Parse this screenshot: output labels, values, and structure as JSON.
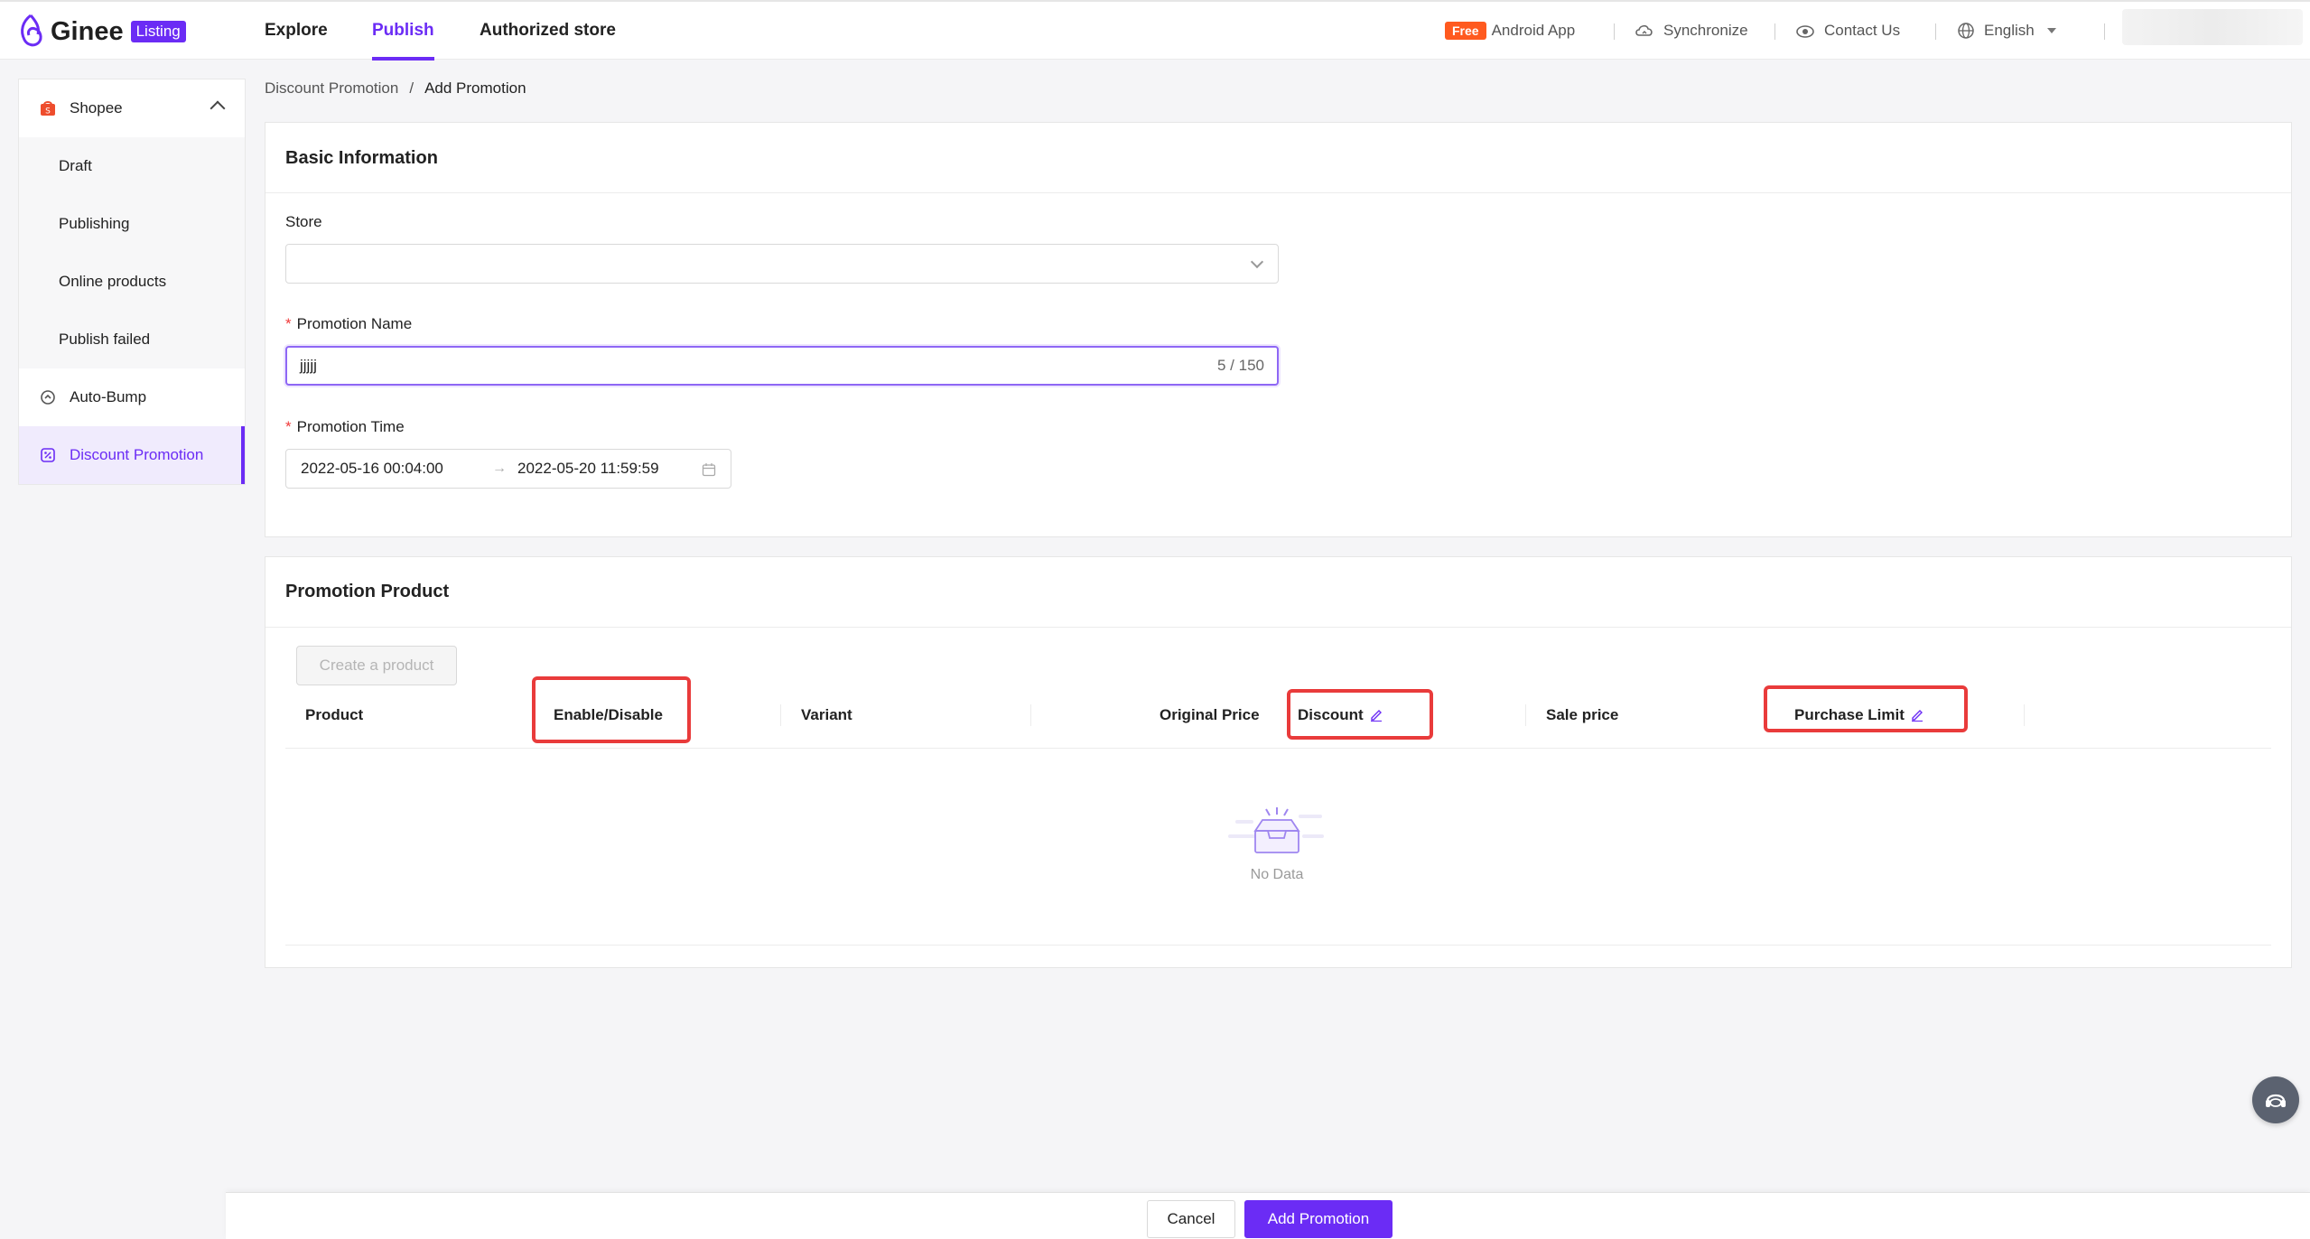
{
  "brand": {
    "name": "Ginee",
    "badge": "Listing",
    "accent": "#6b2cf5"
  },
  "nav": {
    "explore": "Explore",
    "publish": "Publish",
    "authorized_store": "Authorized store"
  },
  "top_actions": {
    "free_badge": "Free",
    "android_app": "Android App",
    "synchronize": "Synchronize",
    "contact_us": "Contact Us",
    "language": "English"
  },
  "sidebar": {
    "platform": "Shopee",
    "items": [
      "Draft",
      "Publishing",
      "Online products",
      "Publish failed"
    ],
    "auto_bump": "Auto-Bump",
    "discount_promotion": "Discount Promotion"
  },
  "breadcrumb": {
    "parent": "Discount Promotion",
    "separator": "/",
    "current": "Add Promotion"
  },
  "basic_info": {
    "title": "Basic Information",
    "store_label": "Store",
    "store_value": "",
    "promotion_name_label": "Promotion Name",
    "promotion_name_value": "jjjjj",
    "promotion_name_count": "5 / 150",
    "promotion_time_label": "Promotion Time",
    "start_time": "2022-05-16 00:04:00",
    "end_time": "2022-05-20 11:59:59",
    "required_mark": "*"
  },
  "promotion_product": {
    "title": "Promotion Product",
    "create_button": "Create a product",
    "columns": [
      "Product",
      "Enable/Disable",
      "Variant",
      "Original Price",
      "Discount",
      "Sale price",
      "Purchase Limit"
    ],
    "empty_text": "No Data"
  },
  "footer": {
    "cancel": "Cancel",
    "submit": "Add Promotion"
  },
  "colors": {
    "accent": "#6b2cf5",
    "highlight_box": "#e93b3b",
    "free_badge": "#ff5a1f"
  }
}
